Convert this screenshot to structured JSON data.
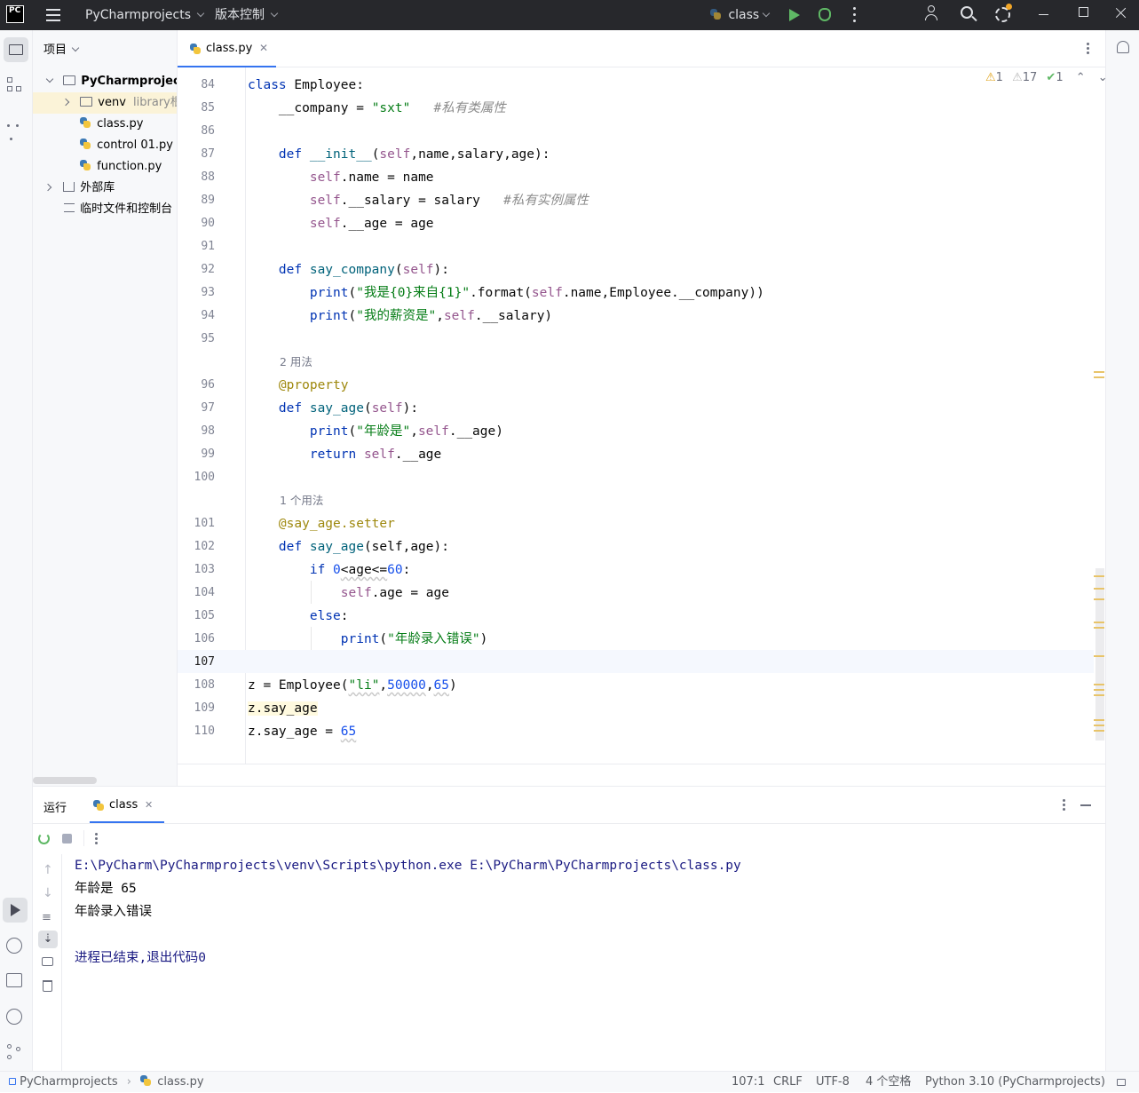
{
  "titlebar": {
    "app_logo": "PC",
    "project_name": "PyCharmprojects",
    "vcs_label": "版本控制",
    "run_config": "class"
  },
  "project_panel": {
    "title": "项目",
    "root": "PyCharmprojects",
    "venv": "venv",
    "venv_hint": "library根目录",
    "files": [
      "class.py",
      "control 01.py",
      "function.py"
    ],
    "external_libs": "外部库",
    "scratches": "临时文件和控制台"
  },
  "editor": {
    "active_tab": "class.py",
    "inspections": {
      "warn_a": "1",
      "warn_b": "17",
      "ok": "1"
    },
    "line_numbers": [
      "84",
      "85",
      "86",
      "87",
      "88",
      "89",
      "90",
      "91",
      "92",
      "93",
      "94",
      "95",
      "96",
      "97",
      "98",
      "99",
      "100",
      "101",
      "102",
      "103",
      "104",
      "105",
      "106",
      "107",
      "108",
      "109",
      "110"
    ],
    "hint_two_usages": "2 用法",
    "hint_one_usage": "1 个用法",
    "code": {
      "l84_kw": "class",
      "l84_rest": " Employee:",
      "l85_var": "    __company = ",
      "l85_str": "\"sxt\"",
      "l85_cm": "   #私有类属性",
      "l87_kw": "    def ",
      "l87_fn": "__init__",
      "l87_p1": "(",
      "l87_self": "self",
      "l87_rest": ",name,salary,age):",
      "l88_self": "        self",
      "l88_rest": ".name = name",
      "l89_self": "        self",
      "l89_rest": ".__salary = salary",
      "l89_cm": "   #私有实例属性",
      "l90_self": "        self",
      "l90_rest": ".__age = age",
      "l92_kw": "    def ",
      "l92_fn": "say_company",
      "l92_p": "(",
      "l92_self": "self",
      "l92_end": "):",
      "l93_fn": "        print",
      "l93_p": "(",
      "l93_str": "\"我是{0}来自{1}\"",
      "l93_mid": ".format(",
      "l93_self": "self",
      "l93_rest": ".name,Employee.__company))",
      "l94_fn": "        print",
      "l94_p": "(",
      "l94_str": "\"我的薪资是\"",
      "l94_c": ",",
      "l94_self": "self",
      "l94_rest": ".__salary)",
      "l96_dc": "    @property",
      "l97_kw": "    def ",
      "l97_fn": "say_age",
      "l97_p": "(",
      "l97_self": "self",
      "l97_end": "):",
      "l98_fn": "        print",
      "l98_p": "(",
      "l98_str": "\"年龄是\"",
      "l98_c": ",",
      "l98_self": "self",
      "l98_rest": ".__age)",
      "l99_kw": "        return ",
      "l99_self": "self",
      "l99_rest": ".__age",
      "l101_dc": "    @say_age.setter",
      "l102_kw": "    def ",
      "l102_fn": "say_age",
      "l102_rest": "(self,age):",
      "l103_kw": "        if ",
      "l103_n1": "0",
      "l103_mid": "<age<=",
      "l103_n2": "60",
      "l103_end": ":",
      "l104_self": "            self",
      "l104_rest": ".age = age",
      "l105_kw": "        else",
      "l105_end": ":",
      "l106_fn": "            print",
      "l106_p": "(",
      "l106_str": "\"年龄录入错误\"",
      "l106_end": ")",
      "l108_a": "z = Employee(",
      "l108_str": "\"li\"",
      "l108_c": ",",
      "l108_n1": "50000",
      "l108_c2": ",",
      "l108_n2": "65",
      "l108_end": ")",
      "l109": "z.say_age",
      "l110_a": "z.say_age = ",
      "l110_n": "65"
    }
  },
  "run_panel": {
    "title": "运行",
    "tab": "class",
    "output": [
      "E:\\PyCharm\\PyCharmprojects\\venv\\Scripts\\python.exe E:\\PyCharm\\PyCharmprojects\\class.py",
      "年龄是 65",
      "年龄录入错误",
      "",
      "进程已结束,退出代码0"
    ]
  },
  "statusbar": {
    "breadcrumb_project": "PyCharmprojects",
    "breadcrumb_file": "class.py",
    "position": "107:1",
    "line_sep": "CRLF",
    "encoding": "UTF-8",
    "indent": "4 个空格",
    "interpreter": "Python 3.10 (PyCharmprojects)"
  }
}
